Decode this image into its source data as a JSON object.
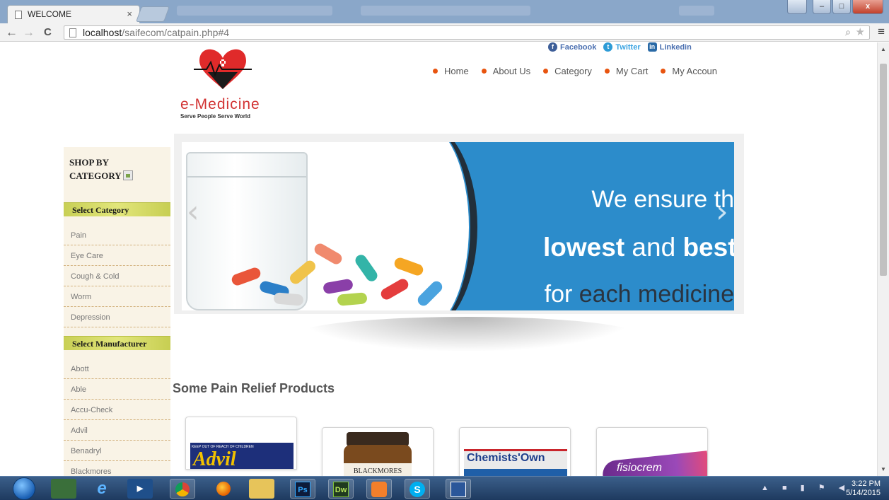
{
  "browser": {
    "tab_title": "WELCOME",
    "tab_close": "×",
    "url_host": "localhost",
    "url_path": "/saifecom/catpain.php#4",
    "back": "←",
    "forward": "→",
    "reload": "C",
    "zoom_icon": "⌕",
    "star_icon": "★",
    "menu_icon": "≡",
    "win_min": "–",
    "win_max": "□",
    "win_close": "x"
  },
  "social": [
    {
      "label": "Facebook",
      "icon": "f"
    },
    {
      "label": "Twitter",
      "icon": "t"
    },
    {
      "label": "Linkedin",
      "icon": "in"
    }
  ],
  "brand": {
    "name": "e-Medicine",
    "tagline": "Serve People Serve World"
  },
  "nav": [
    {
      "label": "Home"
    },
    {
      "label": "About Us"
    },
    {
      "label": "Category"
    },
    {
      "label": "My Cart"
    },
    {
      "label": "My Accoun"
    }
  ],
  "sidebar": {
    "heading": "SHOP BY CATEGORY",
    "category_title": "Select Category",
    "categories": [
      "Pain",
      "Eye Care",
      "Cough & Cold",
      "Worm",
      "Depression"
    ],
    "manufacturer_title": "Select Manufacturer",
    "manufacturers": [
      "Abott",
      "Able",
      "Accu-Check",
      "Advil",
      "Benadryl",
      "Blackmores"
    ]
  },
  "slider": {
    "line1": "We ensure th",
    "line2_bold1": "lowest",
    "line2_mid": " and ",
    "line2_bold2": "best pric",
    "line3_a": "for ",
    "line3_b": "each medicine",
    "prev": "‹",
    "next": "›"
  },
  "products": {
    "title": "Some Pain Relief Products",
    "items": [
      {
        "label": "Advil",
        "top_text": "KEEP OUT OF REACH OF CHILDREN"
      },
      {
        "label": "BLACKMORES"
      },
      {
        "label": "Chemists'Own"
      },
      {
        "label": "fisiocrem"
      }
    ]
  },
  "taskbar": {
    "time": "3:22 PM",
    "date": "5/14/2015",
    "apps": [
      "Ps",
      "Dw",
      "S"
    ]
  }
}
